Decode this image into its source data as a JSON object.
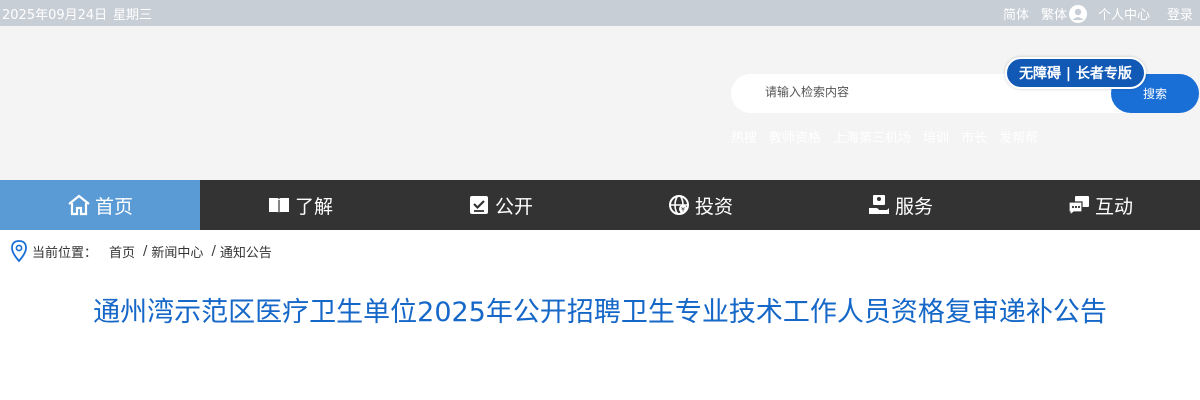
{
  "topbar": {
    "date": "2025年09月24日",
    "weekday": "星期三",
    "simplified": "简体",
    "traditional": "繁体",
    "user_center": "个人中心",
    "login": "登录"
  },
  "header": {
    "accessibility": "无障碍 | 长者专版",
    "search": {
      "placeholder": "请输入检索内容",
      "button": "搜索"
    },
    "hot_words": [
      "热搜",
      "教师资格",
      "上海第三机场",
      "培训",
      "市长",
      "发帮帮"
    ]
  },
  "nav": {
    "items": [
      {
        "label": "首页",
        "icon": "home-icon"
      },
      {
        "label": "了解",
        "icon": "book-icon"
      },
      {
        "label": "公开",
        "icon": "check-board-icon"
      },
      {
        "label": "投资",
        "icon": "globe-icon"
      },
      {
        "label": "服务",
        "icon": "hand-service-icon"
      },
      {
        "label": "互动",
        "icon": "chat-icon"
      }
    ],
    "active_index": 0
  },
  "breadcrumb": {
    "label": "当前位置：",
    "items": [
      "首页",
      "新闻中心",
      "通知公告"
    ],
    "separator": "/"
  },
  "article": {
    "title": "通州湾示范区医疗卫生单位2025年公开招聘卫生专业技术工作人员资格复审递补公告"
  },
  "colors": {
    "topbar_bg": "#c8ced6",
    "header_bg": "#f4f4f4",
    "nav_bg": "#333333",
    "nav_active": "#5b9bd5",
    "accent": "#1a6fd6",
    "title_color": "#1567c8"
  }
}
